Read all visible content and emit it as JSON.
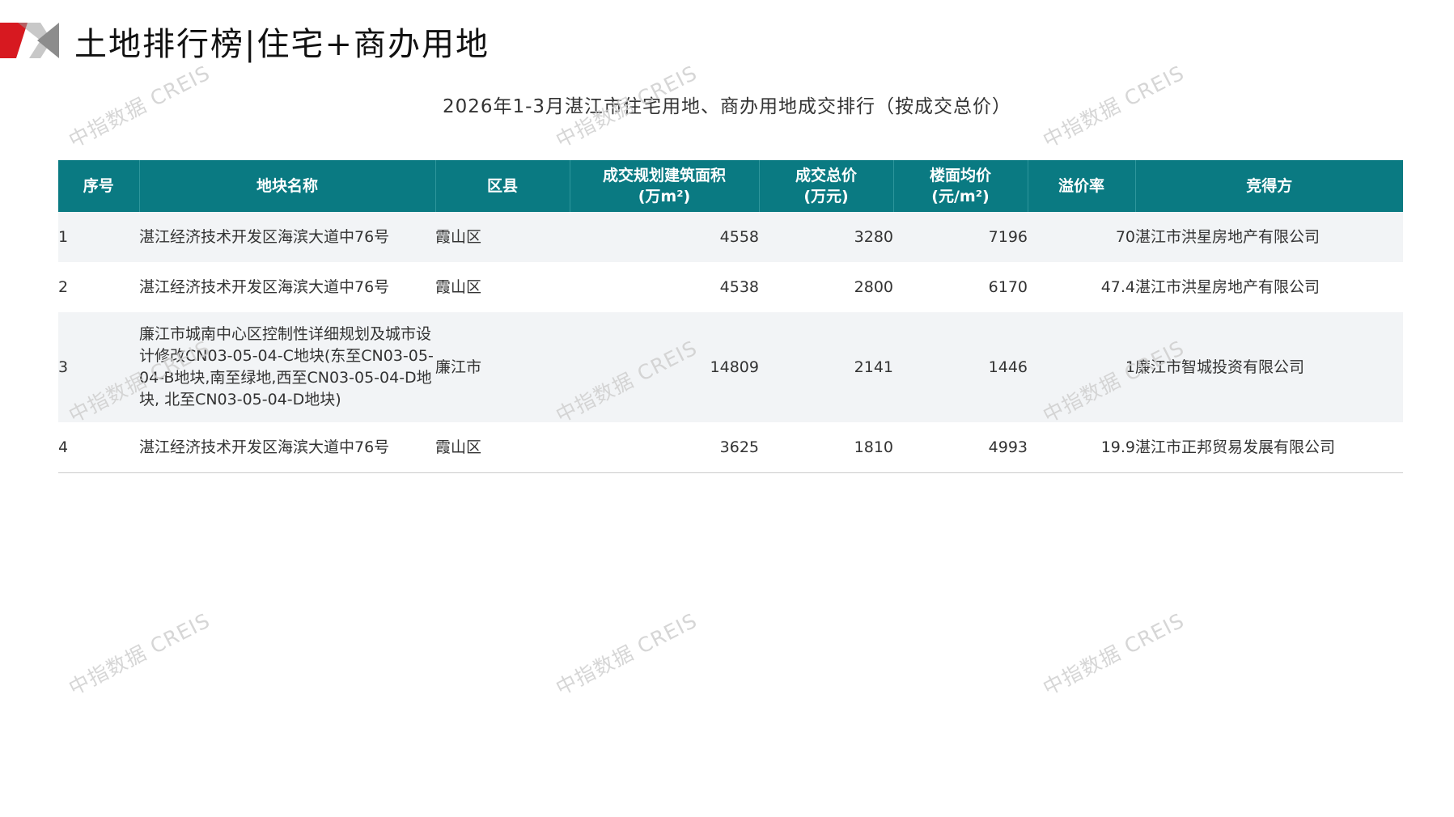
{
  "header": {
    "page_title": "土地排行榜|住宅+商办用地",
    "report_title": "2026年1-3月湛江市住宅用地、商办用地成交排行（按成交总价）"
  },
  "watermark": {
    "text": "中指数据 CREIS"
  },
  "colors": {
    "header_bg": "#0a7a82",
    "price_text": "#c0141c",
    "brand_red": "#d71920"
  },
  "table": {
    "columns": {
      "rank": "序号",
      "name": "地块名称",
      "district": "区县",
      "area_line1": "成交规划建筑面积",
      "area_line2": "(万m²)",
      "total_line1": "成交总价",
      "total_line2": "(万元)",
      "unit_line1": "楼面均价",
      "unit_line2": "(元/m²)",
      "premium": "溢价率",
      "buyer": "竞得方"
    },
    "rows": [
      {
        "rank": "1",
        "name": "湛江经济技术开发区海滨大道中76号",
        "district": "霞山区",
        "area": "4558",
        "total": "3280",
        "unit_price": "7196",
        "premium": "70",
        "buyer": "湛江市洪星房地产有限公司"
      },
      {
        "rank": "2",
        "name": "湛江经济技术开发区海滨大道中76号",
        "district": "霞山区",
        "area": "4538",
        "total": "2800",
        "unit_price": "6170",
        "premium": "47.4",
        "buyer": "湛江市洪星房地产有限公司"
      },
      {
        "rank": "3",
        "name": "廉江市城南中心区控制性详细规划及城市设计修改CN03-05-04-C地块(东至CN03-05-04-B地块,南至绿地,西至CN03-05-04-D地块, 北至CN03-05-04-D地块)",
        "district": "廉江市",
        "area": "14809",
        "total": "2141",
        "unit_price": "1446",
        "premium": "1",
        "buyer": "廉江市智城投资有限公司"
      },
      {
        "rank": "4",
        "name": "湛江经济技术开发区海滨大道中76号",
        "district": "霞山区",
        "area": "3625",
        "total": "1810",
        "unit_price": "4993",
        "premium": "19.9",
        "buyer": "湛江市正邦贸易发展有限公司"
      }
    ]
  }
}
